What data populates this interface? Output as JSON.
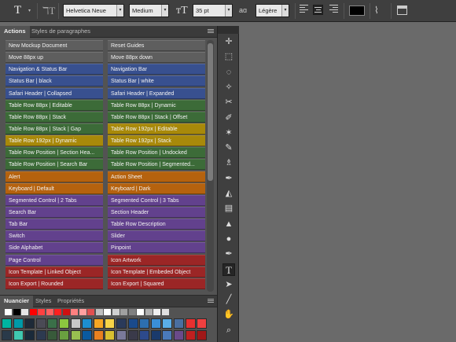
{
  "options_bar": {
    "font_family": "Helvetica Neue",
    "font_style": "Medium",
    "font_size": "35 pt",
    "aa_label": "aɑ",
    "antialias": "Légère",
    "text_color": "#000000"
  },
  "actions_panel": {
    "tabs": [
      "Actions",
      "Styles de paragraphes"
    ],
    "rows": [
      {
        "left": {
          "label": "New Mockup Document",
          "color": "#5e5e5e"
        },
        "right": {
          "label": "Reset Guides",
          "color": "#5e5e5e"
        }
      },
      {
        "left": {
          "label": "Move 88px up",
          "color": "#5e5e5e"
        },
        "right": {
          "label": "Move 88px down",
          "color": "#5e5e5e"
        }
      },
      {
        "left": {
          "label": "Navigation & Status Bar",
          "color": "#38508f"
        },
        "right": {
          "label": "Navigation Bar",
          "color": "#38508f"
        }
      },
      {
        "left": {
          "label": "Status Bar | black",
          "color": "#38508f"
        },
        "right": {
          "label": "Status Bar | white",
          "color": "#38508f"
        }
      },
      {
        "left": {
          "label": "Safari Header | Collapsed",
          "color": "#38508f"
        },
        "right": {
          "label": "Safari Header | Expanded",
          "color": "#38508f"
        }
      },
      {
        "left": {
          "label": "Table Row 88px | Editable",
          "color": "#3c6b38"
        },
        "right": {
          "label": "Table Row 88px | Dynamic",
          "color": "#3c6b38"
        }
      },
      {
        "left": {
          "label": "Table Row 88px | Stack",
          "color": "#3c6b38"
        },
        "right": {
          "label": "Table Row 88px | Stack | Offset",
          "color": "#3c6b38"
        }
      },
      {
        "left": {
          "label": "Table Row 88px | Stack | Gap",
          "color": "#3c6b38"
        },
        "right": {
          "label": "Table Row 192px | Editable",
          "color": "#a8890a"
        }
      },
      {
        "left": {
          "label": "Table Row 192px | Dynamic",
          "color": "#a8890a"
        },
        "right": {
          "label": "Table Row 192px | Stack",
          "color": "#a8890a"
        }
      },
      {
        "left": {
          "label": "Table Row Position | Section Hea...",
          "color": "#3c6b38"
        },
        "right": {
          "label": "Table Row Position | Undocked",
          "color": "#3c6b38"
        }
      },
      {
        "left": {
          "label": "Table Row Position | Search Bar",
          "color": "#3c6b38"
        },
        "right": {
          "label": "Table Row Position | Segmented...",
          "color": "#3c6b38"
        }
      },
      {
        "left": {
          "label": "Alert",
          "color": "#b5620e"
        },
        "right": {
          "label": "Action Sheet",
          "color": "#b5620e"
        }
      },
      {
        "left": {
          "label": "Keyboard | Default",
          "color": "#b5620e"
        },
        "right": {
          "label": "Keyboard | Dark",
          "color": "#b5620e"
        }
      },
      {
        "left": {
          "label": "Segmented Control | 2 Tabs",
          "color": "#62418d"
        },
        "right": {
          "label": "Segmented Control | 3 Tabs",
          "color": "#62418d"
        }
      },
      {
        "left": {
          "label": "Search Bar",
          "color": "#62418d"
        },
        "right": {
          "label": "Section Header",
          "color": "#62418d"
        }
      },
      {
        "left": {
          "label": "Tab Bar",
          "color": "#62418d"
        },
        "right": {
          "label": "Table Row Description",
          "color": "#62418d"
        }
      },
      {
        "left": {
          "label": "Switch",
          "color": "#62418d"
        },
        "right": {
          "label": "Slider",
          "color": "#62418d"
        }
      },
      {
        "left": {
          "label": "Side Alphabet",
          "color": "#62418d"
        },
        "right": {
          "label": "Pinpoint",
          "color": "#62418d"
        }
      },
      {
        "left": {
          "label": "Page Control",
          "color": "#62418d"
        },
        "right": {
          "label": "Icon Artwork",
          "color": "#9b2626"
        }
      },
      {
        "left": {
          "label": "Icon Template | Linked Object",
          "color": "#9b2626"
        },
        "right": {
          "label": "Icon Template | Embeded Object",
          "color": "#9b2626"
        }
      },
      {
        "left": {
          "label": "Icon Export | Rounded",
          "color": "#9b2626"
        },
        "right": {
          "label": "Icon Export | Squared",
          "color": "#9b2626"
        }
      }
    ]
  },
  "swatches_panel": {
    "tabs": [
      "Nuancier",
      "Styles",
      "Propriétés"
    ],
    "small_colors": [
      "#ffffff",
      "#000000",
      "#e6e6e6",
      "#ff0000",
      "#ff4040",
      "#ff6060",
      "#ff2020",
      "#d01010",
      "#ff8080",
      "#ffa0a0",
      "#e05050",
      "#c0c0c0",
      "#ffffff",
      "#d0d0d0",
      "#a0a0a0",
      "#808080",
      "#ffffff",
      "#b0b0b0",
      "#f0f0f0",
      "#e0e0e0"
    ],
    "colors_row1": [
      "#00b5a0",
      "#009aa8",
      "#1e2a38",
      "#4a4a55",
      "#3a6f48",
      "#8cc63f",
      "#c8c8c8",
      "#1d8fd0",
      "#f5a623",
      "#f7d348",
      "#2a3a5a",
      "#1a4a8c",
      "#2d6fb0",
      "#3a8fd8",
      "#5aaee8",
      "#4a6fa0",
      "#e83030",
      "#f04040"
    ],
    "colors_row2": [
      "#2a3a4a",
      "#40c8b0",
      "#1a2a3a",
      "#2d3a50",
      "#385a3a",
      "#6aa040",
      "#98c050",
      "#0a5aa0",
      "#e88020",
      "#d8c030",
      "#7a7a9a",
      "#3a3a4a",
      "#2d4a8c",
      "#1a3a6c",
      "#4a7aba",
      "#6a4a8a",
      "#c02020",
      "#a01818"
    ]
  },
  "tools": [
    {
      "name": "move-tool-icon",
      "glyph": "✛"
    },
    {
      "name": "marquee-tool-icon",
      "glyph": "⬚"
    },
    {
      "name": "lasso-tool-icon",
      "glyph": "◌"
    },
    {
      "name": "magic-wand-tool-icon",
      "glyph": "✧"
    },
    {
      "name": "crop-tool-icon",
      "glyph": "✂"
    },
    {
      "name": "eyedropper-tool-icon",
      "glyph": "✐"
    },
    {
      "name": "healing-brush-tool-icon",
      "glyph": "✶"
    },
    {
      "name": "brush-tool-icon",
      "glyph": "✎"
    },
    {
      "name": "clone-stamp-tool-icon",
      "glyph": "♗"
    },
    {
      "name": "history-brush-tool-icon",
      "glyph": "✒"
    },
    {
      "name": "eraser-tool-icon",
      "glyph": "◭"
    },
    {
      "name": "gradient-tool-icon",
      "glyph": "▤"
    },
    {
      "name": "blur-tool-icon",
      "glyph": "▲"
    },
    {
      "name": "dodge-tool-icon",
      "glyph": "●"
    },
    {
      "name": "pen-tool-icon",
      "glyph": "✒"
    },
    {
      "name": "type-tool-icon",
      "glyph": "T"
    },
    {
      "name": "path-selection-tool-icon",
      "glyph": "➤"
    },
    {
      "name": "line-tool-icon",
      "glyph": "╱"
    },
    {
      "name": "hand-tool-icon",
      "glyph": "✋"
    },
    {
      "name": "zoom-tool-icon",
      "glyph": "⌕"
    }
  ]
}
